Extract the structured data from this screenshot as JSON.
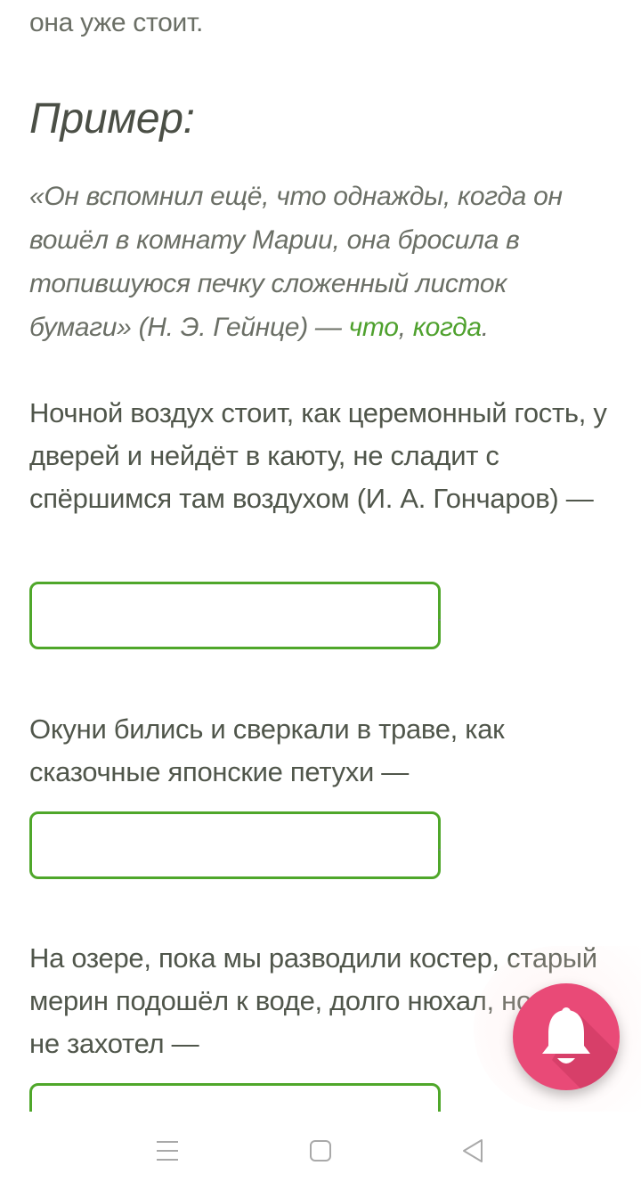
{
  "content": {
    "prev_line": "она уже стоит.",
    "example": {
      "heading": "Пример:",
      "quote": "«Он вспомнил ещё, что однажды, когда он вошёл в комнату Марии, она бросила в топившуюся печку сложенный листок бумаги» (Н. Э. Гейнце) — ",
      "answer_1": "что",
      "separator": ", ",
      "answer_2": "когда",
      "end": "."
    },
    "questions": [
      {
        "text": "Ночной воздух стоит, как церемонный гость, у дверей и нейдёт в каюту, не сладит с спёршимся там воздухом (И. А. Гончаров) —",
        "answer_value": "",
        "after": "."
      },
      {
        "text": "Окуни бились и сверкали в траве, как сказочные японские петухи —",
        "answer_value": "",
        "after": "."
      },
      {
        "text": "На озере, пока мы разводили костер, старый мерин подошёл к воде, долго нюхал, но пить не захотел —",
        "answer_value": ""
      }
    ]
  },
  "fab": {
    "icon": "bell-icon",
    "color": "#e94a77"
  },
  "colors": {
    "accent_green": "#4fa72a",
    "answer_text_green": "#4fa12e",
    "text": "#555b50"
  },
  "navbar": {
    "menu_icon": "menu-icon",
    "home_icon": "home-square-icon",
    "back_icon": "back-triangle-icon"
  }
}
